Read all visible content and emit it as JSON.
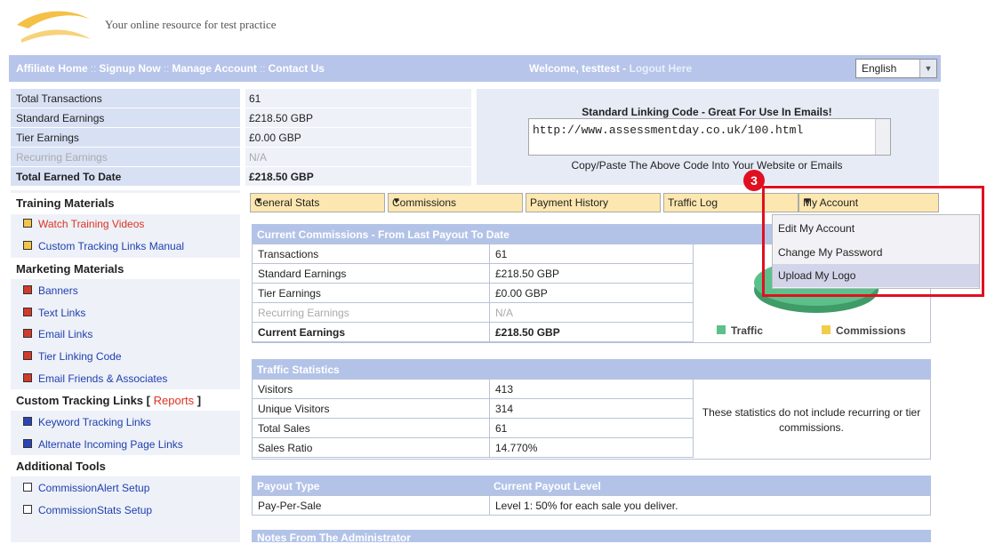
{
  "header": {
    "tagline": "Your online resource for test practice"
  },
  "nav": {
    "links": [
      "Affiliate Home",
      "Signup Now",
      "Manage Account",
      "Contact Us"
    ],
    "separator": "::",
    "welcome": "Welcome, testtest",
    "logout": "Logout Here",
    "language": "English"
  },
  "stats": [
    {
      "label": "Total Transactions",
      "value": "61"
    },
    {
      "label": "Standard Earnings",
      "value": "£218.50 GBP"
    },
    {
      "label": "Tier Earnings",
      "value": "£0.00 GBP"
    },
    {
      "label": "Recurring Earnings",
      "value": "N/A"
    },
    {
      "label": "Total Earned To Date",
      "value": "£218.50 GBP"
    }
  ],
  "linking": {
    "title": "Standard Linking Code - Great For Use In Emails!",
    "code": "http://www.assessmentday.co.uk/100.html",
    "hint": "Copy/Paste The Above Code Into Your Website or Emails"
  },
  "sidebar": {
    "training_title": "Training Materials",
    "training": [
      "Watch Training Videos",
      "Custom Tracking Links Manual"
    ],
    "marketing_title": "Marketing Materials",
    "marketing": [
      "Banners",
      "Text Links",
      "Email Links",
      "Tier Linking Code",
      "Email Friends & Associates"
    ],
    "custom_title": "Custom Tracking Links",
    "custom_reports": "Reports",
    "custom": [
      "Keyword Tracking Links",
      "Alternate Incoming Page Links"
    ],
    "tools_title": "Additional Tools",
    "tools": [
      "CommissionAlert Setup",
      "CommissionStats Setup"
    ]
  },
  "tabs": {
    "general": "General Stats",
    "commissions": "Commissions",
    "payment": "Payment History",
    "traffic": "Traffic Log",
    "account": "My Account"
  },
  "menu": {
    "items": [
      "Edit My Account",
      "Change My Password",
      "Upload My Logo"
    ],
    "step": "3"
  },
  "commissions_panel": {
    "title": "Current Commissions - From Last Payout To Date",
    "rows": [
      {
        "label": "Transactions",
        "value": "61"
      },
      {
        "label": "Standard Earnings",
        "value": "£218.50 GBP"
      },
      {
        "label": "Tier Earnings",
        "value": "£0.00 GBP"
      },
      {
        "label": "Recurring Earnings",
        "value": "N/A"
      },
      {
        "label": "Current Earnings",
        "value": "£218.50 GBP"
      }
    ],
    "legend_traffic": "Traffic",
    "legend_commissions": "Commissions",
    "colors": {
      "traffic": "#5cc08a",
      "commissions": "#f2cc4a"
    }
  },
  "traffic_panel": {
    "title": "Traffic Statistics",
    "rows": [
      {
        "label": "Visitors",
        "value": "413"
      },
      {
        "label": "Unique Visitors",
        "value": "314"
      },
      {
        "label": "Total Sales",
        "value": "61"
      },
      {
        "label": "Sales Ratio",
        "value": "14.770%"
      }
    ],
    "note": "These statistics do not include recurring or tier commissions."
  },
  "payout_panel": {
    "type_header": "Payout Type",
    "level_header": "Current Payout Level",
    "type": "Pay-Per-Sale",
    "level": "Level 1: 50% for each sale you deliver."
  },
  "notes_panel": {
    "title": "Notes From The Administrator"
  }
}
